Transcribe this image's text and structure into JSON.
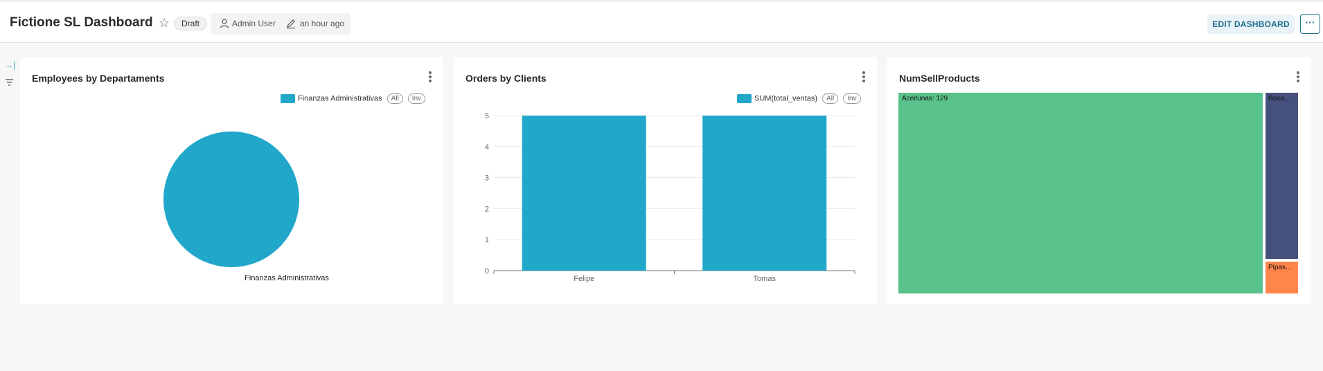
{
  "header": {
    "title": "Fictione SL Dashboard",
    "status_badge": "Draft",
    "owner": "Admin User",
    "modified": "an hour ago",
    "edit_button": "EDIT DASHBOARD",
    "more_button": "···"
  },
  "sidebar": {
    "expand_icon": "→|",
    "filter_icon": "filter-icon"
  },
  "panels": [
    {
      "title": "Employees by Departaments",
      "legend": {
        "label": "Finanzas Administrativas",
        "all": "All",
        "inv": "Inv"
      }
    },
    {
      "title": "Orders by Clients",
      "legend": {
        "label": "SUM(total_ventas)",
        "all": "All",
        "inv": "Inv"
      }
    },
    {
      "title": "NumSellProducts"
    }
  ],
  "chart_data": [
    {
      "type": "pie",
      "title": "Employees by Departaments",
      "categories": [
        "Finanzas Administrativas"
      ],
      "values": [
        1
      ],
      "labels": [
        "Finanzas Administrativas"
      ],
      "colors": [
        "#20a7c9"
      ]
    },
    {
      "type": "bar",
      "title": "Orders by Clients",
      "categories": [
        "Felipe",
        "Tomas"
      ],
      "series": [
        {
          "name": "SUM(total_ventas)",
          "values": [
            5,
            5
          ]
        }
      ],
      "ylim": [
        0,
        5
      ],
      "yticks": [
        "0",
        "1",
        "2",
        "3",
        "4",
        "5"
      ],
      "grid": true,
      "color": "#20a7c9"
    },
    {
      "type": "treemap",
      "title": "NumSellProducts",
      "items": [
        {
          "label": "Aceitunas: 129",
          "color": "#59c28a"
        },
        {
          "label": "Boca...",
          "color": "#46507c"
        },
        {
          "label": "Pipas...",
          "color": "#ff854a"
        }
      ],
      "values": [
        129,
        8,
        2
      ]
    }
  ]
}
